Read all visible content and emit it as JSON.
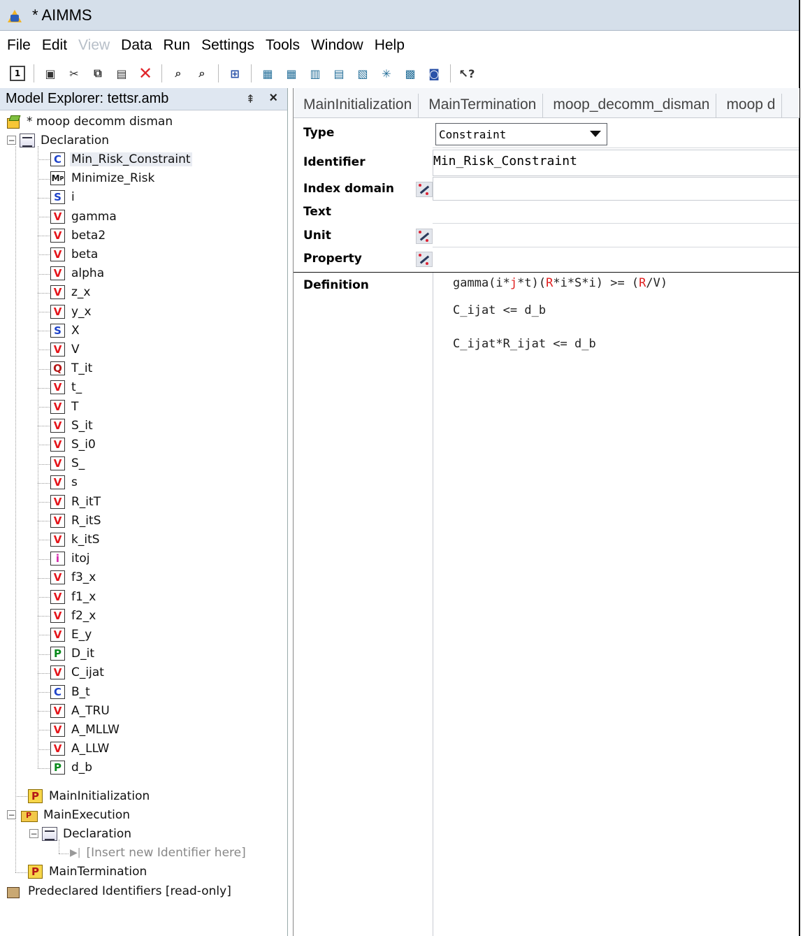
{
  "window": {
    "title": "* AIMMS"
  },
  "menu": {
    "items": [
      {
        "label": "File",
        "disabled": false
      },
      {
        "label": "Edit",
        "disabled": false
      },
      {
        "label": "View",
        "disabled": true
      },
      {
        "label": "Data",
        "disabled": false
      },
      {
        "label": "Run",
        "disabled": false
      },
      {
        "label": "Settings",
        "disabled": false
      },
      {
        "label": "Tools",
        "disabled": false
      },
      {
        "label": "Window",
        "disabled": false
      },
      {
        "label": "Help",
        "disabled": false
      }
    ]
  },
  "toolbar": {
    "icons": [
      "new-document-icon",
      "save-icon",
      "cut-icon",
      "copy-icon",
      "paste-icon",
      "delete-icon",
      "find-icon",
      "find-next-icon",
      "zoom-icon",
      "identifier-selector-icon",
      "page-manager-icon",
      "template-manager-icon",
      "menu-builder-icon",
      "data-manager-icon",
      "solver-icon",
      "library-icon",
      "user-icon",
      "help-icon"
    ],
    "delete_glyph": "✕",
    "help_glyph": "?"
  },
  "explorer": {
    "title": "Model Explorer: tettsr.amb",
    "pin_glyph": "⇞",
    "close_glyph": "×",
    "root_label": "* moop decomm disman",
    "declaration_label": "Declaration",
    "identifiers": [
      {
        "type": "C",
        "name": "Min_Risk_Constraint",
        "selected": true
      },
      {
        "type": "M",
        "name": "Minimize_Risk"
      },
      {
        "type": "S",
        "name": "i"
      },
      {
        "type": "V",
        "name": "gamma"
      },
      {
        "type": "V",
        "name": "beta2"
      },
      {
        "type": "V",
        "name": "beta"
      },
      {
        "type": "V",
        "name": "alpha"
      },
      {
        "type": "V",
        "name": "z_x"
      },
      {
        "type": "V",
        "name": "y_x"
      },
      {
        "type": "S",
        "name": "X"
      },
      {
        "type": "V",
        "name": "V"
      },
      {
        "type": "Q",
        "name": "T_it"
      },
      {
        "type": "V",
        "name": "t_"
      },
      {
        "type": "V",
        "name": "T"
      },
      {
        "type": "V",
        "name": "S_it"
      },
      {
        "type": "V",
        "name": "S_i0"
      },
      {
        "type": "V",
        "name": "S_"
      },
      {
        "type": "V",
        "name": "s"
      },
      {
        "type": "V",
        "name": "R_itT"
      },
      {
        "type": "V",
        "name": "R_itS"
      },
      {
        "type": "V",
        "name": "k_itS"
      },
      {
        "type": "I",
        "name": "itoj"
      },
      {
        "type": "V",
        "name": "f3_x"
      },
      {
        "type": "V",
        "name": "f1_x"
      },
      {
        "type": "V",
        "name": "f2_x"
      },
      {
        "type": "V",
        "name": "E_y"
      },
      {
        "type": "P",
        "name": "D_it"
      },
      {
        "type": "V",
        "name": "C_ijat"
      },
      {
        "type": "C",
        "name": "B_t"
      },
      {
        "type": "V",
        "name": "A_TRU"
      },
      {
        "type": "V",
        "name": "A_MLLW"
      },
      {
        "type": "V",
        "name": "A_LLW"
      },
      {
        "type": "P",
        "name": "d_b"
      }
    ],
    "procedures": {
      "main_initialization": "MainInitialization",
      "main_execution": "MainExecution",
      "exec_declaration": "Declaration",
      "insert_placeholder": "[Insert new Identifier here]",
      "main_termination": "MainTermination"
    },
    "predeclared": "Predeclared Identifiers [read-only]"
  },
  "editor": {
    "tabs": [
      "MainInitialization",
      "MainTermination",
      "moop_decomm_disman",
      "moop d"
    ],
    "labels": {
      "type": "Type",
      "identifier": "Identifier",
      "index_domain": "Index domain",
      "text": "Text",
      "unit": "Unit",
      "property": "Property",
      "definition": "Definition"
    },
    "type_value": "Constraint",
    "identifier_value": "Min_Risk_Constraint",
    "definition_lines": [
      [
        {
          "t": "gamma(i*",
          "c": "n"
        },
        {
          "t": "j",
          "c": "h"
        },
        {
          "t": "*t)(",
          "c": "n"
        },
        {
          "t": "R",
          "c": "h"
        },
        {
          "t": "*i*S*i) >= (",
          "c": "n"
        },
        {
          "t": "R",
          "c": "h"
        },
        {
          "t": "/V)",
          "c": "n"
        }
      ],
      [
        {
          "t": "C_ijat <= d_b",
          "c": "n"
        }
      ],
      [
        {
          "t": "C_ijat*R_ijat <= d_b",
          "c": "n"
        }
      ]
    ],
    "highlight_color": "#e02020"
  }
}
